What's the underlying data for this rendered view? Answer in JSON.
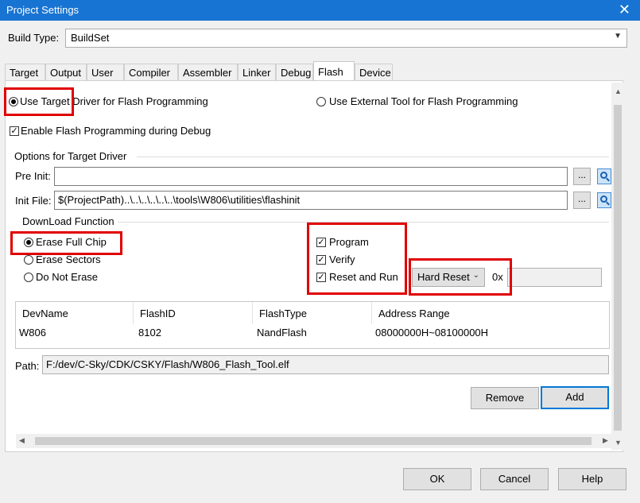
{
  "window": {
    "title": "Project Settings"
  },
  "build_type": {
    "label": "Build Type:",
    "value": "BuildSet"
  },
  "tabs": [
    {
      "label": "Target"
    },
    {
      "label": "Output"
    },
    {
      "label": "User"
    },
    {
      "label": "Compiler"
    },
    {
      "label": "Assembler"
    },
    {
      "label": "Linker"
    },
    {
      "label": "Debug"
    },
    {
      "label": "Flash"
    },
    {
      "label": "Device"
    }
  ],
  "active_tab": "Flash",
  "flash": {
    "use_target_driver": "Use Target Driver for Flash Programming",
    "use_external_tool": "Use External Tool for Flash Programming",
    "enable_during_debug": "Enable Flash Programming during Debug",
    "options_group": "Options for Target Driver",
    "pre_init_label": "Pre Init:",
    "pre_init_value": "",
    "init_file_label": "Init File:",
    "init_file_value": "$(ProjectPath)..\\..\\..\\..\\..\\..\\tools\\W806\\utilities\\flashinit",
    "browse": "...",
    "download_group": "DownLoad Function",
    "erase_full": "Erase Full Chip",
    "erase_sectors": "Erase Sectors",
    "do_not_erase": "Do Not Erase",
    "program": "Program",
    "verify": "Verify",
    "reset_and_run": "Reset and Run",
    "reset_mode": "Hard Reset",
    "hex_prefix": "0x",
    "hex_value": "",
    "table": {
      "headers": [
        "DevName",
        "FlashID",
        "FlashType",
        "Address Range"
      ],
      "rows": [
        [
          "W806",
          "8102",
          "NandFlash",
          "08000000H~08100000H"
        ]
      ]
    },
    "path_label": "Path:",
    "path_value": "F:/dev/C-Sky/CDK/CSKY/Flash/W806_Flash_Tool.elf",
    "remove": "Remove",
    "add": "Add"
  },
  "footer": {
    "ok": "OK",
    "cancel": "Cancel",
    "help": "Help"
  },
  "icons": {
    "close": "close-icon",
    "search": "magnifier-icon",
    "dropdown": "chevron-down-icon"
  }
}
